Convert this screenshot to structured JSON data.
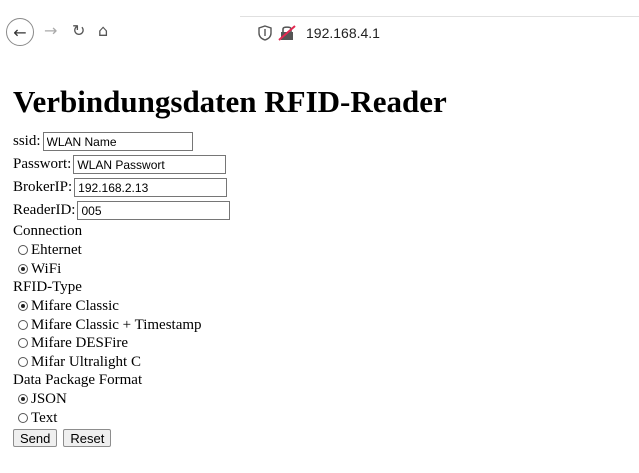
{
  "browser": {
    "url": "192.168.4.1"
  },
  "page": {
    "title": "Verbindungsdaten RFID-Reader",
    "fields": [
      {
        "label": "ssid:",
        "value": "WLAN Name"
      },
      {
        "label": "Passwort:",
        "value": "WLAN Passwort"
      },
      {
        "label": "BrokerIP:",
        "value": "192.168.2.13"
      },
      {
        "label": "ReaderID:",
        "value": "005"
      }
    ],
    "connection": {
      "label": "Connection",
      "options": [
        {
          "label": "Ehternet",
          "selected": false
        },
        {
          "label": "WiFi",
          "selected": true
        }
      ]
    },
    "rfid": {
      "label": "RFID-Type",
      "options": [
        {
          "label": "Mifare Classic",
          "selected": true
        },
        {
          "label": "Mifare Classic + Timestamp",
          "selected": false
        },
        {
          "label": "Mifare DESFire",
          "selected": false
        },
        {
          "label": "Mifar Ultralight C",
          "selected": false
        }
      ]
    },
    "format": {
      "label": "Data Package Format",
      "options": [
        {
          "label": "JSON",
          "selected": true
        },
        {
          "label": "Text",
          "selected": false
        }
      ]
    },
    "buttons": {
      "send": "Send",
      "reset": "Reset"
    }
  }
}
